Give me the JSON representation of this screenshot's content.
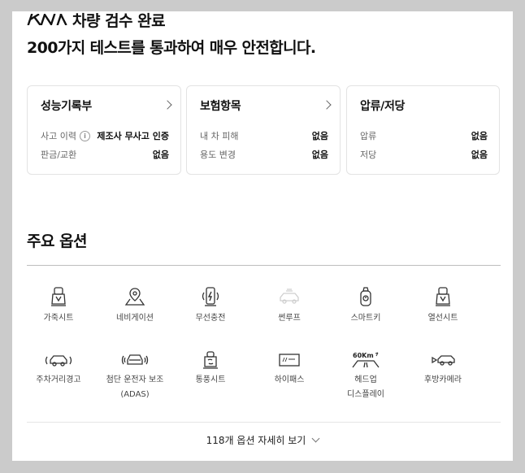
{
  "header": {
    "title": "차량 검수 완료",
    "subtitle": "200가지 테스트를 통과하여 매우 안전합니다."
  },
  "cards": [
    {
      "title": "성능기록부",
      "has_link": true,
      "rows": [
        {
          "label": "사고 이력",
          "value": "제조사 무사고 인증",
          "info": true
        },
        {
          "label": "판금/교환",
          "value": "없음"
        }
      ]
    },
    {
      "title": "보험항목",
      "has_link": true,
      "rows": [
        {
          "label": "내 차 피해",
          "value": "없음"
        },
        {
          "label": "용도 변경",
          "value": "없음"
        }
      ]
    },
    {
      "title": "압류/저당",
      "has_link": false,
      "rows": [
        {
          "label": "압류",
          "value": "없음"
        },
        {
          "label": "저당",
          "value": "없음"
        }
      ]
    }
  ],
  "options_section": {
    "title": "주요 옵션",
    "items": [
      {
        "label": "가죽시트",
        "icon": "seat-icon",
        "enabled": true
      },
      {
        "label": "네비게이션",
        "icon": "navigation-icon",
        "enabled": true
      },
      {
        "label": "무선충전",
        "icon": "wireless-charging-icon",
        "enabled": true
      },
      {
        "label": "썬루프",
        "icon": "sunroof-icon",
        "enabled": false
      },
      {
        "label": "스마트키",
        "icon": "smart-key-icon",
        "enabled": true
      },
      {
        "label": "열선시트",
        "icon": "heated-seat-icon",
        "enabled": true
      },
      {
        "label": "주차거리경고",
        "icon": "parking-sensor-icon",
        "enabled": true
      },
      {
        "label": "첨단 운전자 보조",
        "label2": "(ADAS)",
        "icon": "adas-icon",
        "enabled": true
      },
      {
        "label": "통풍시트",
        "icon": "ventilated-seat-icon",
        "enabled": true
      },
      {
        "label": "하이패스",
        "icon": "hipass-icon",
        "enabled": true
      },
      {
        "label": "헤드업",
        "label2": "디스플레이",
        "icon": "hud-icon",
        "hud_text": "60Km",
        "enabled": true
      },
      {
        "label": "후방카메라",
        "icon": "rear-camera-icon",
        "enabled": true
      }
    ],
    "more_label": "118개 옵션 자세히 보기"
  }
}
